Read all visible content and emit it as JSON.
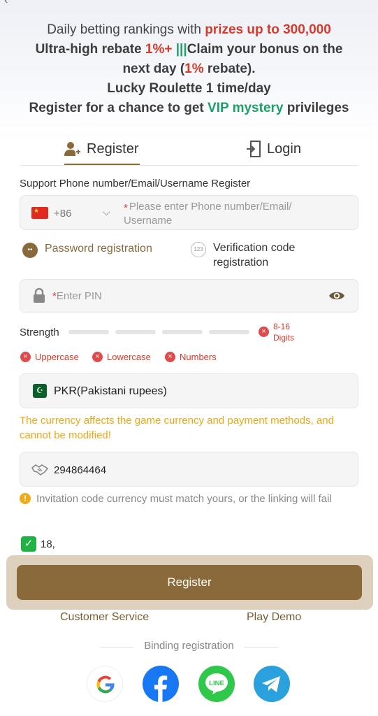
{
  "promo": {
    "line1_pre": "Daily betting rankings with ",
    "line1_hl": "prizes up to 300,000",
    "line2_pre": "Ultra-high rebate ",
    "line2_hl": "1%+",
    "line2_sep": " |||",
    "line2_post": "Claim your bonus on the",
    "line3_pre": "next day (",
    "line3_hl": "1%",
    "line3_post": " rebate).",
    "line4": "Lucky Roulette 1 time/day",
    "line5_pre": "Register for a chance to get ",
    "line5_hl": "VIP mystery",
    "line5_post": " privileges"
  },
  "tabs": {
    "register": "Register",
    "login": "Login"
  },
  "phone": {
    "support_label": "Support Phone number/Email/Username Register",
    "country_code": "+86",
    "required_mark": "*",
    "placeholder": "Please enter Phone number/Email/ Username"
  },
  "reg_types": {
    "password": "Password registration",
    "verification": "Verification code registration",
    "verification_icon": "123"
  },
  "pin": {
    "required_mark": "*",
    "placeholder": "Enter PIN"
  },
  "strength": {
    "label": "Strength",
    "digits_rule": "8-16 Digits",
    "rules": [
      "Uppercase",
      "Lowercase",
      "Numbers"
    ]
  },
  "currency": {
    "value": "PKR(Pakistani rupees)",
    "note": "The currency affects the game currency and payment methods, and cannot be modified!"
  },
  "invite": {
    "value": "294864464",
    "note": "Invitation code currency must match yours, or the linking will fail"
  },
  "agree": {
    "text": "18,"
  },
  "actions": {
    "register": "Register",
    "customer_service": "Customer Service",
    "play_demo": "Play Demo"
  },
  "binding": {
    "label": "Binding registration"
  },
  "social": [
    "google-icon",
    "facebook-icon",
    "line-icon",
    "telegram-icon"
  ],
  "colors": {
    "brand": "#8a6a3a",
    "highlight_red": "#d43b2b",
    "highlight_green": "#1f9e6a",
    "warning": "#e8a817"
  }
}
